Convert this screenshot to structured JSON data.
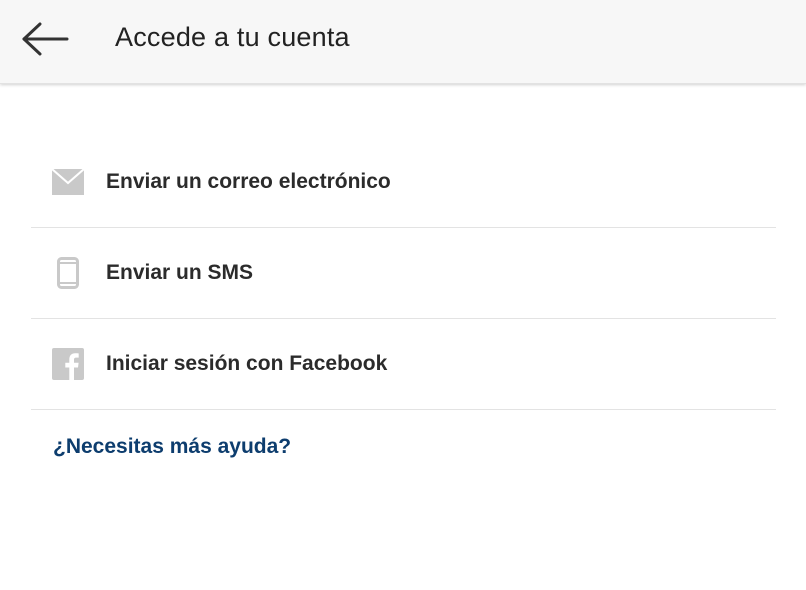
{
  "header": {
    "title": "Accede a tu cuenta",
    "back_icon": "arrow-left-icon"
  },
  "options": [
    {
      "label": "Enviar un correo electrónico",
      "icon": "envelope-icon"
    },
    {
      "label": "Enviar un SMS",
      "icon": "smartphone-icon"
    },
    {
      "label": "Iniciar sesión con Facebook",
      "icon": "facebook-icon"
    }
  ],
  "help": {
    "label": "¿Necesitas más ayuda?"
  },
  "colors": {
    "header_bg": "#f7f7f7",
    "text_primary": "#2b2b2b",
    "link": "#0d3d6e",
    "icon_gray": "#c9c9c9",
    "divider": "#e3e3e3"
  }
}
